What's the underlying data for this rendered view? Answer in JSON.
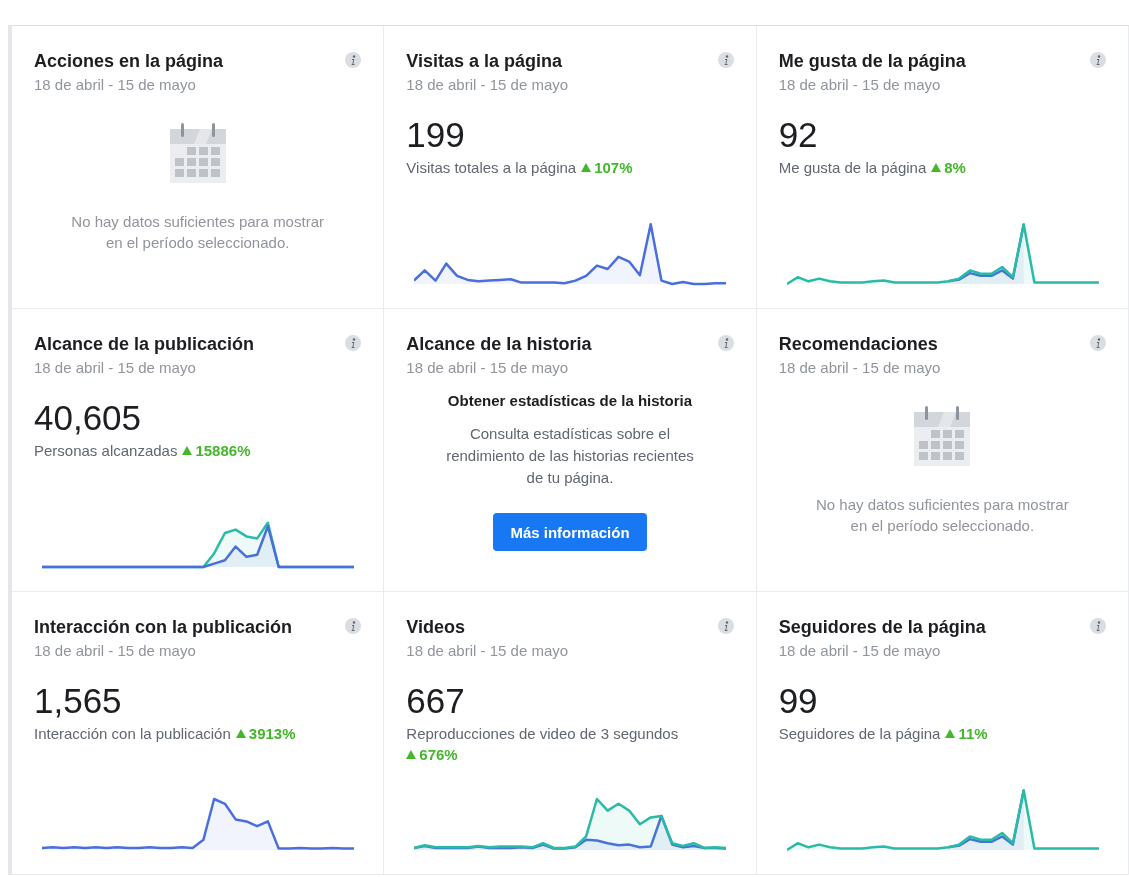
{
  "cards": [
    {
      "kind": "empty",
      "title": "Acciones en la página",
      "date": "18 de abril - 15 de mayo",
      "message": "No hay datos suficientes para mostrar en el período seleccionado."
    },
    {
      "kind": "metric",
      "title": "Visitas a la página",
      "date": "18 de abril - 15 de mayo",
      "value": "199",
      "caption": "Visitas totales a la página",
      "change": "107%"
    },
    {
      "kind": "metric",
      "title": "Me gusta de la página",
      "date": "18 de abril - 15 de mayo",
      "value": "92",
      "caption": "Me gusta de la página",
      "change": "8%"
    },
    {
      "kind": "metric",
      "title": "Alcance de la publicación",
      "date": "18 de abril - 15 de mayo",
      "value": "40,605",
      "caption": "Personas alcanzadas",
      "change": "15886%"
    },
    {
      "kind": "promo",
      "title": "Alcance de la historia",
      "date": "18 de abril - 15 de mayo",
      "heading": "Obtener estadísticas de la historia",
      "message": "Consulta estadísticas sobre el rendimiento de las historias recientes de tu página.",
      "button": "Más información"
    },
    {
      "kind": "empty",
      "title": "Recomendaciones",
      "date": "18 de abril - 15 de mayo",
      "message": "No hay datos suficientes para mostrar en el período seleccionado."
    },
    {
      "kind": "metric",
      "title": "Interacción con la publicación",
      "date": "18 de abril - 15 de mayo",
      "value": "1,565",
      "caption": "Interacción con la publicación",
      "change": "3913%"
    },
    {
      "kind": "metric",
      "title": "Videos",
      "date": "18 de abril - 15 de mayo",
      "value": "667",
      "caption": "Reproducciones de video de 3 segundos",
      "change": "676%"
    },
    {
      "kind": "metric",
      "title": "Seguidores de la página",
      "date": "18 de abril - 15 de mayo",
      "value": "99",
      "caption": "Seguidores de la página",
      "change": "11%"
    }
  ]
}
